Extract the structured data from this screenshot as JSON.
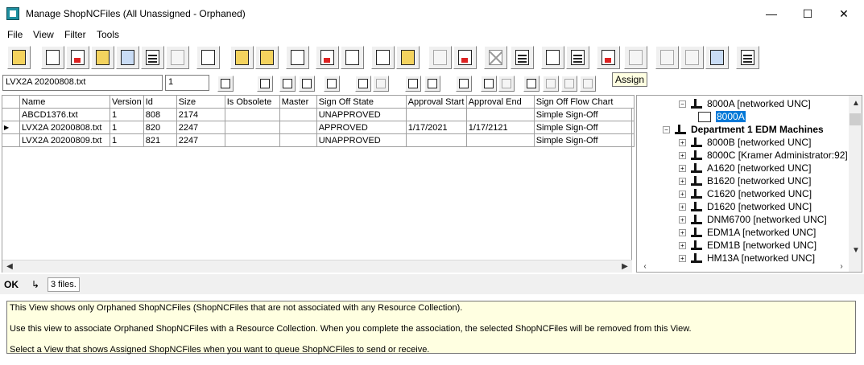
{
  "window": {
    "title": "Manage ShopNCFiles (All Unassigned - Orphaned)",
    "minimize": "—",
    "maximize": "☐",
    "close": "✕"
  },
  "menu": [
    "File",
    "View",
    "Filter",
    "Tools"
  ],
  "tooltip": "Assign",
  "filter": {
    "name_value": "LVX2A 20200808.txt",
    "version_value": "1"
  },
  "grid": {
    "columns": [
      "Name",
      "Version",
      "Id",
      "Size",
      "Is Obsolete",
      "Master",
      "Sign Off State",
      "Approval Start",
      "Approval End",
      "Sign Off Flow Chart"
    ],
    "rows": [
      {
        "current": false,
        "cells": [
          "ABCD1376.txt",
          "1",
          "808",
          "2174",
          "",
          "",
          "UNAPPROVED",
          "",
          "",
          "Simple Sign-Off"
        ]
      },
      {
        "current": true,
        "cells": [
          "LVX2A 20200808.txt",
          "1",
          "820",
          "2247",
          "",
          "",
          "APPROVED",
          "1/17/2021",
          "1/17/2121",
          "Simple Sign-Off"
        ]
      },
      {
        "current": false,
        "cells": [
          "LVX2A 20200809.txt",
          "1",
          "821",
          "2247",
          "",
          "",
          "UNAPPROVED",
          "",
          "",
          "Simple Sign-Off"
        ]
      }
    ]
  },
  "tree": {
    "items": [
      {
        "label": "8000A [networked UNC]",
        "level": 1,
        "expander": "−",
        "icon": "machine-icon",
        "bold": false
      },
      {
        "label": "8000A",
        "level": 2,
        "expander": "",
        "icon": "network-folder-icon",
        "bold": false,
        "selected": true
      },
      {
        "label": "Department 1 EDM Machines",
        "level": 0,
        "expander": "−",
        "icon": "department-icon",
        "bold": true
      },
      {
        "label": "8000B [networked UNC]",
        "level": 1,
        "expander": "+",
        "icon": "machine-icon",
        "bold": false
      },
      {
        "label": "8000C [Kramer Administrator:92]",
        "level": 1,
        "expander": "+",
        "icon": "machine-icon",
        "bold": false
      },
      {
        "label": "A1620 [networked UNC]",
        "level": 1,
        "expander": "+",
        "icon": "machine-icon",
        "bold": false
      },
      {
        "label": "B1620 [networked UNC]",
        "level": 1,
        "expander": "+",
        "icon": "machine-icon",
        "bold": false
      },
      {
        "label": "C1620 [networked UNC]",
        "level": 1,
        "expander": "+",
        "icon": "machine-icon",
        "bold": false
      },
      {
        "label": "D1620 [networked UNC]",
        "level": 1,
        "expander": "+",
        "icon": "machine-icon",
        "bold": false
      },
      {
        "label": "DNM6700 [networked UNC]",
        "level": 1,
        "expander": "+",
        "icon": "machine-icon",
        "bold": false
      },
      {
        "label": "EDM1A [networked UNC]",
        "level": 1,
        "expander": "+",
        "icon": "machine-icon",
        "bold": false
      },
      {
        "label": "EDM1B [networked UNC]",
        "level": 1,
        "expander": "+",
        "icon": "machine-icon",
        "bold": false
      },
      {
        "label": "HM13A [networked UNC]",
        "level": 1,
        "expander": "+",
        "icon": "machine-icon",
        "bold": false
      }
    ]
  },
  "status": {
    "ok_label": "OK",
    "arrow_glyph": "↳",
    "file_count": "3 files."
  },
  "info": [
    "This View shows only Orphaned ShopNCFiles (ShopNCFiles that are not associated with any Resource Collection).",
    "Use this view to associate Orphaned ShopNCFiles with a Resource Collection. When you complete the association, the selected ShopNCFiles will be removed from this View.",
    "Select a View that shows Assigned ShopNCFiles when you want to queue ShopNCFiles to send or receive."
  ],
  "colors": {
    "accent_selection": "#0078d7",
    "info_background": "#ffffe1"
  }
}
